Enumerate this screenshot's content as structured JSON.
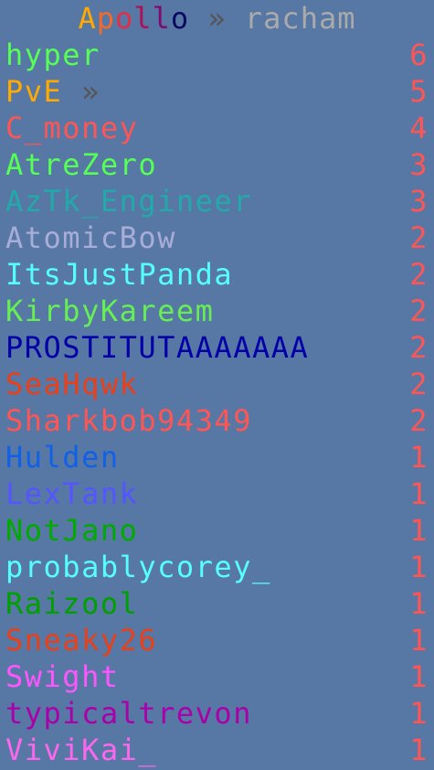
{
  "title": {
    "server_letters": [
      {
        "ch": "A",
        "color": "#ffaa00"
      },
      {
        "ch": "p",
        "color": "#f26a2a"
      },
      {
        "ch": "o",
        "color": "#e03048"
      },
      {
        "ch": "l",
        "color": "#b0105a"
      },
      {
        "ch": "l",
        "color": "#800a70"
      },
      {
        "ch": "o",
        "color": "#0a0a60"
      }
    ],
    "server": "Apollo",
    "separator": "»",
    "mode": "racham",
    "mode_color": "#aaaaaa"
  },
  "rows": [
    {
      "name": "hyper",
      "score": "6",
      "color": "#55ff55"
    },
    {
      "name": "PvE",
      "suffix": "»",
      "score": "5",
      "color": "#ffaa00"
    },
    {
      "name": "C_money",
      "score": "4",
      "color": "#ff5555"
    },
    {
      "name": "AtreZero",
      "score": "3",
      "color": "#55ff55"
    },
    {
      "name": "AzTk_Engineer",
      "score": "3",
      "color": "#22aaaa"
    },
    {
      "name": "AtomicBow",
      "score": "2",
      "color": "#a8acd8"
    },
    {
      "name": "ItsJustPanda",
      "score": "2",
      "color": "#55ffff"
    },
    {
      "name": "KirbyKareem",
      "score": "2",
      "color": "#66ee55"
    },
    {
      "name": "PROSTITUTAAAAAAA",
      "score": "2",
      "color": "#0000aa"
    },
    {
      "name": "SeaHqwk",
      "score": "2",
      "color": "#e8401a"
    },
    {
      "name": "Sharkbob94349",
      "score": "2",
      "color": "#ff5555"
    },
    {
      "name": "Hulden",
      "score": "1",
      "color": "#1060e8"
    },
    {
      "name": "LexTank",
      "score": "1",
      "color": "#5555ff"
    },
    {
      "name": "NotJano",
      "score": "1",
      "color": "#00aa00"
    },
    {
      "name": "probablycorey_",
      "score": "1",
      "color": "#55ffff"
    },
    {
      "name": "Raizool",
      "score": "1",
      "color": "#00a000"
    },
    {
      "name": "Sneaky26",
      "score": "1",
      "color": "#e8401a"
    },
    {
      "name": "Swight",
      "score": "1",
      "color": "#ff55ff"
    },
    {
      "name": "typicaltrevon",
      "score": "1",
      "color": "#aa00aa"
    },
    {
      "name": "ViviKai_",
      "score": "1",
      "color": "#ff66ee"
    }
  ]
}
